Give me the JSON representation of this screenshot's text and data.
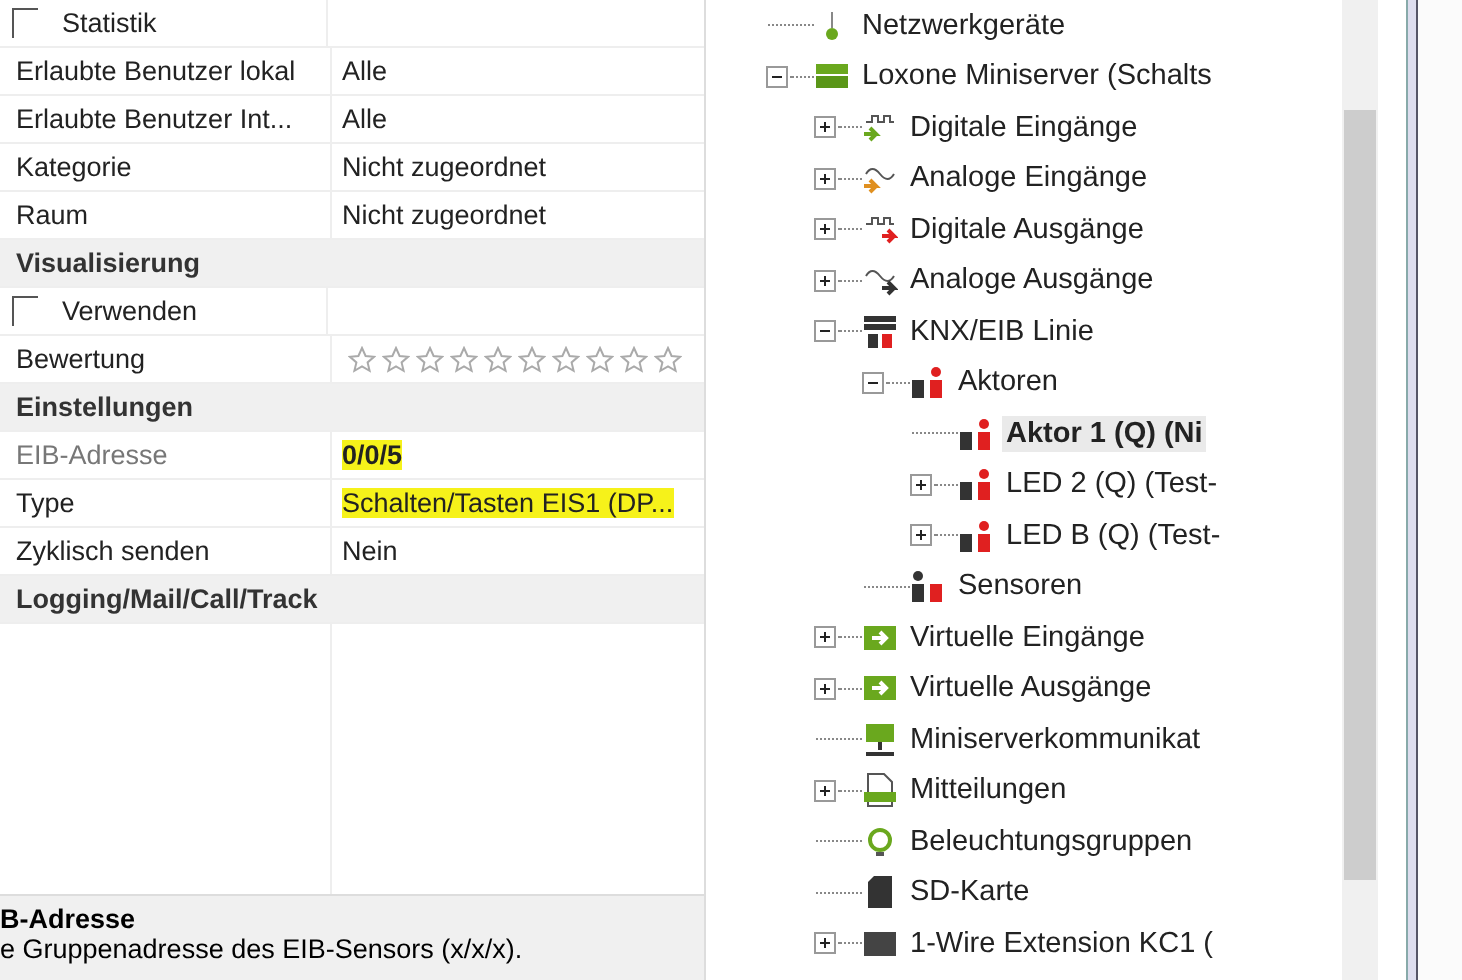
{
  "properties": [
    {
      "kind": "checkbox",
      "label": "Statistik",
      "checked": false
    },
    {
      "kind": "property",
      "label": "Erlaubte Benutzer lokal",
      "value": "Alle",
      "readonly": false,
      "modified": false,
      "highlighted": false
    },
    {
      "kind": "property",
      "label": "Erlaubte Benutzer Int...",
      "value": "Alle",
      "readonly": false,
      "modified": false,
      "highlighted": false
    },
    {
      "kind": "property",
      "label": "Kategorie",
      "value": "Nicht zugeordnet",
      "readonly": false,
      "modified": false,
      "highlighted": false
    },
    {
      "kind": "property",
      "label": "Raum",
      "value": "Nicht zugeordnet",
      "readonly": false,
      "modified": false,
      "highlighted": false
    },
    {
      "kind": "category",
      "label": "Visualisierung"
    },
    {
      "kind": "checkbox",
      "label": "Verwenden",
      "checked": false
    },
    {
      "kind": "stars",
      "label": "Bewertung",
      "stars": 0
    },
    {
      "kind": "category",
      "label": "Einstellungen"
    },
    {
      "kind": "property",
      "label": "EIB-Adresse",
      "value": "0/0/5",
      "readonly": true,
      "modified": true,
      "highlighted": true
    },
    {
      "kind": "property",
      "label": "Type",
      "value": "Schalten/Tasten EIS1 (DP...",
      "readonly": false,
      "modified": false,
      "highlighted": true
    },
    {
      "kind": "property",
      "label": "Zyklisch senden",
      "value": "Nein",
      "readonly": false,
      "modified": false,
      "highlighted": false
    },
    {
      "kind": "category",
      "label": "Logging/Mail/Call/Track"
    }
  ],
  "description": {
    "title": "B-Adresse",
    "text": "e Gruppenadresse des EIB-Sensors (x/x/x)."
  },
  "tree": [
    {
      "label": "Netzwerkgeräte",
      "kind": "network",
      "selected": false
    },
    {
      "label": "Loxone Miniserver (Schalts",
      "kind": "miniserver",
      "expanded": true,
      "selected": false,
      "children": [
        {
          "label": "Digitale Eingänge",
          "kind": "digitalin",
          "expanded": false,
          "selected": false
        },
        {
          "label": "Analoge Eingänge",
          "kind": "analogin",
          "expanded": false,
          "selected": false
        },
        {
          "label": "Digitale Ausgänge",
          "kind": "digitalout",
          "expanded": false,
          "selected": false
        },
        {
          "label": "Analoge Ausgänge",
          "kind": "analogout",
          "expanded": false,
          "selected": false
        },
        {
          "label": "KNX/EIB Linie",
          "kind": "knx",
          "expanded": true,
          "selected": false,
          "children": [
            {
              "label": "Aktoren",
              "kind": "actor",
              "expanded": true,
              "selected": false,
              "children": [
                {
                  "label": "Aktor 1 (Q) (Ni",
                  "kind": "actor",
                  "selected": true
                },
                {
                  "label": "LED 2 (Q) (Test-",
                  "kind": "actor",
                  "expanded": false,
                  "selected": false
                },
                {
                  "label": "LED B (Q) (Test-",
                  "kind": "actor",
                  "expanded": false,
                  "selected": false
                }
              ]
            },
            {
              "label": "Sensoren",
              "kind": "sensor",
              "selected": false
            }
          ]
        },
        {
          "label": "Virtuelle Eingänge",
          "kind": "virtualin",
          "expanded": false,
          "selected": false
        },
        {
          "label": "Virtuelle Ausgänge",
          "kind": "virtualout",
          "expanded": false,
          "selected": false
        },
        {
          "label": "Miniserverkommunikat",
          "kind": "comm",
          "selected": false
        },
        {
          "label": "Mitteilungen",
          "kind": "log",
          "expanded": false,
          "selected": false
        },
        {
          "label": "Beleuchtungsgruppen",
          "kind": "light",
          "selected": false
        },
        {
          "label": "SD-Karte",
          "kind": "sdcard",
          "selected": false
        },
        {
          "label": "1-Wire Extension KC1 (",
          "kind": "extension",
          "expanded": false,
          "selected": false
        }
      ]
    }
  ]
}
